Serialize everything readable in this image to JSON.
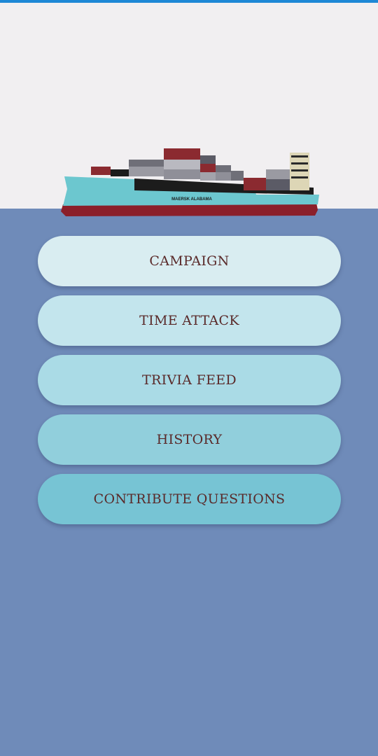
{
  "ship": {
    "hull_text": "MAERSK ALABAMA"
  },
  "menu": {
    "items": [
      {
        "label": "CAMPAIGN"
      },
      {
        "label": "TIME ATTACK"
      },
      {
        "label": "TRIVIA FEED"
      },
      {
        "label": "HISTORY"
      },
      {
        "label": "CONTRIBUTE QUESTIONS"
      }
    ]
  },
  "colors": {
    "sky": "#f1eff1",
    "sea": "#6f8bb9",
    "status_strip": "#1e88d6",
    "button_text": "#5a2a2a",
    "buttons": [
      "#d9edf1",
      "#c3e5ed",
      "#aadbe6",
      "#91cfdc",
      "#77c4d4"
    ]
  }
}
